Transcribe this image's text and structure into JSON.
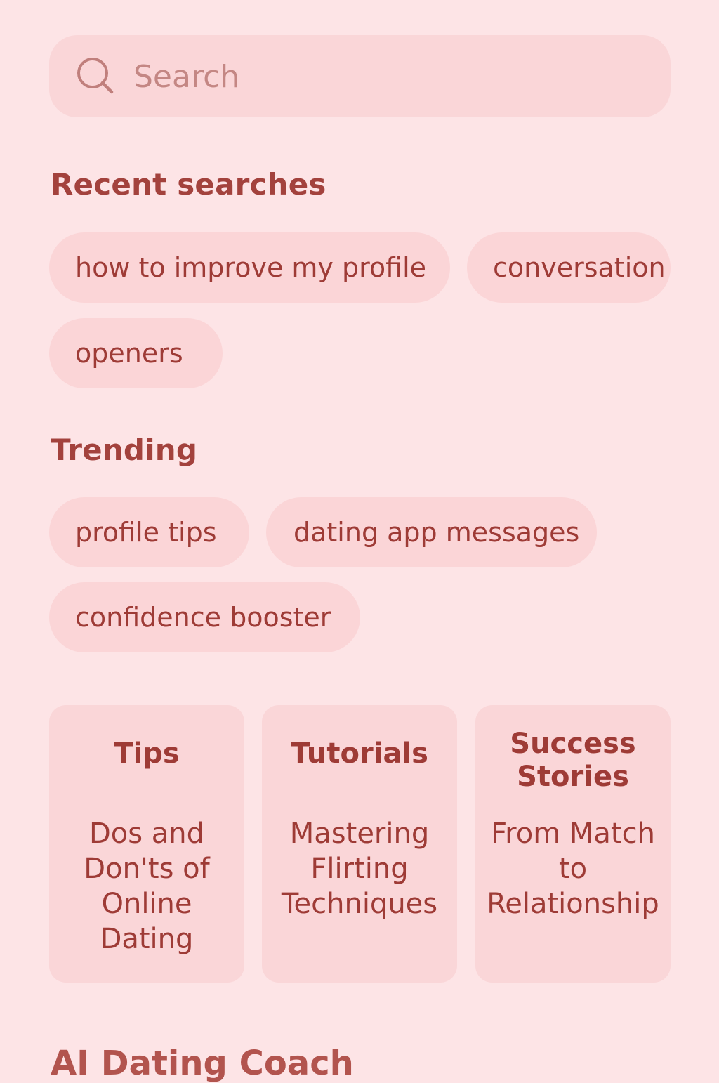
{
  "search": {
    "placeholder": "Search",
    "icon": "search-icon"
  },
  "recent": {
    "title": "Recent searches",
    "items": [
      "how to improve my profile",
      "conversation",
      "openers"
    ]
  },
  "trending": {
    "title": "Trending",
    "items": [
      "profile tips",
      "dating app messages",
      "confidence booster"
    ]
  },
  "cards": [
    {
      "heading": "Tips",
      "body": "Dos and Don'ts of Online Dating"
    },
    {
      "heading": "Tutorials",
      "body": "Mastering Flirting Techniques"
    },
    {
      "heading": "Success Stories",
      "body": "From Match to Relationship"
    }
  ],
  "footer": {
    "title": "AI Dating Coach"
  },
  "colors": {
    "background": "#fde4e6",
    "chip": "#fbd5d7",
    "accent": "#a3423d"
  }
}
